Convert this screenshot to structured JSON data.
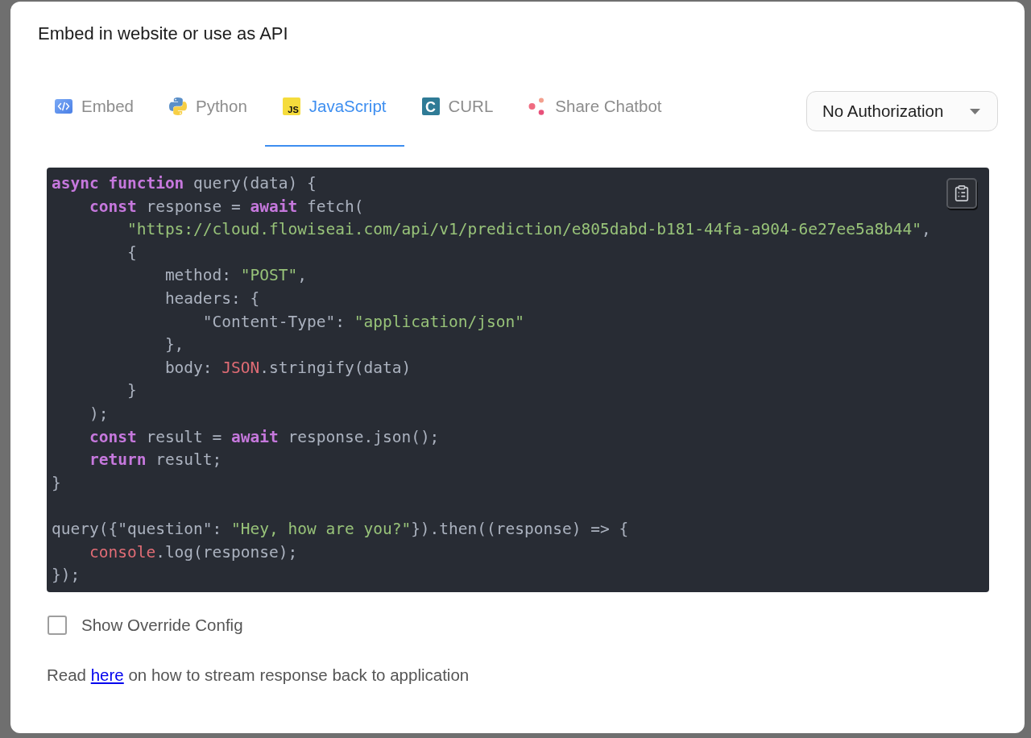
{
  "dialog": {
    "title": "Embed in website or use as API"
  },
  "tabs": [
    {
      "kind": "embed",
      "label": "Embed",
      "selected": false
    },
    {
      "kind": "python",
      "label": "Python",
      "selected": false
    },
    {
      "kind": "javascript",
      "label": "JavaScript",
      "icon_text": "JS",
      "selected": true
    },
    {
      "kind": "curl",
      "label": "CURL",
      "icon_text": "C",
      "selected": false
    },
    {
      "kind": "share",
      "label": "Share Chatbot",
      "selected": false
    }
  ],
  "auth_select": {
    "value": "No Authorization"
  },
  "code": {
    "sections": [
      {
        "lines": [
          {
            "tokens": [
              {
                "text": "async",
                "kind": "keyword"
              },
              {
                "text": " function",
                "kind": "keyword"
              },
              {
                "text": " query(data) {",
                "kind": "plain"
              }
            ]
          },
          {
            "tokens": [
              {
                "text": "    const",
                "kind": "keyword"
              },
              {
                "text": " response = ",
                "kind": "plain"
              },
              {
                "text": "await",
                "kind": "keyword"
              },
              {
                "text": " fetch(",
                "kind": "plain"
              }
            ]
          },
          {
            "tokens": [
              {
                "text": "        \"https://cloud.flowiseai.com/api/v1/prediction/e805dabd-b181-44fa-a904-6e27ee5a8b44\"",
                "kind": "string"
              },
              {
                "text": ",",
                "kind": "plain"
              }
            ]
          },
          {
            "tokens": [
              {
                "text": "        {",
                "kind": "plain"
              }
            ]
          },
          {
            "tokens": [
              {
                "text": "            method: ",
                "kind": "plain"
              },
              {
                "text": "\"POST\"",
                "kind": "string"
              },
              {
                "text": ",",
                "kind": "plain"
              }
            ]
          },
          {
            "tokens": [
              {
                "text": "            headers: {",
                "kind": "plain"
              }
            ]
          },
          {
            "tokens": [
              {
                "text": "                \"Content-Type\": ",
                "kind": "plain"
              },
              {
                "text": "\"application/json\"",
                "kind": "string"
              }
            ]
          },
          {
            "tokens": [
              {
                "text": "            },",
                "kind": "plain"
              }
            ]
          },
          {
            "tokens": [
              {
                "text": "            body: ",
                "kind": "plain"
              },
              {
                "text": "JSON",
                "kind": "builtin"
              },
              {
                "text": ".stringify(data)",
                "kind": "plain"
              }
            ]
          },
          {
            "tokens": [
              {
                "text": "        }",
                "kind": "plain"
              }
            ]
          },
          {
            "tokens": [
              {
                "text": "    );",
                "kind": "plain"
              }
            ]
          },
          {
            "tokens": [
              {
                "text": "    const",
                "kind": "keyword"
              },
              {
                "text": " result = ",
                "kind": "plain"
              },
              {
                "text": "await",
                "kind": "keyword"
              },
              {
                "text": " response.json();",
                "kind": "plain"
              }
            ]
          },
          {
            "tokens": [
              {
                "text": "    return",
                "kind": "keyword"
              },
              {
                "text": " result;",
                "kind": "plain"
              }
            ]
          },
          {
            "tokens": [
              {
                "text": "}",
                "kind": "plain"
              }
            ]
          }
        ]
      },
      {
        "lines": [
          {
            "tokens": [
              {
                "text": "query({\"question\": ",
                "kind": "plain"
              },
              {
                "text": "\"Hey, how are you?\"",
                "kind": "string"
              },
              {
                "text": "}).then((response) => {",
                "kind": "plain"
              }
            ]
          },
          {
            "tokens": [
              {
                "text": "    console",
                "kind": "builtin"
              },
              {
                "text": ".log(response);",
                "kind": "plain"
              }
            ]
          },
          {
            "tokens": [
              {
                "text": "});",
                "kind": "plain"
              }
            ]
          }
        ]
      }
    ]
  },
  "override_config": {
    "label": "Show Override Config",
    "checked": false
  },
  "footer": {
    "text_before": "Read",
    "link": "here",
    "text_after": "on how to stream response back to application"
  }
}
